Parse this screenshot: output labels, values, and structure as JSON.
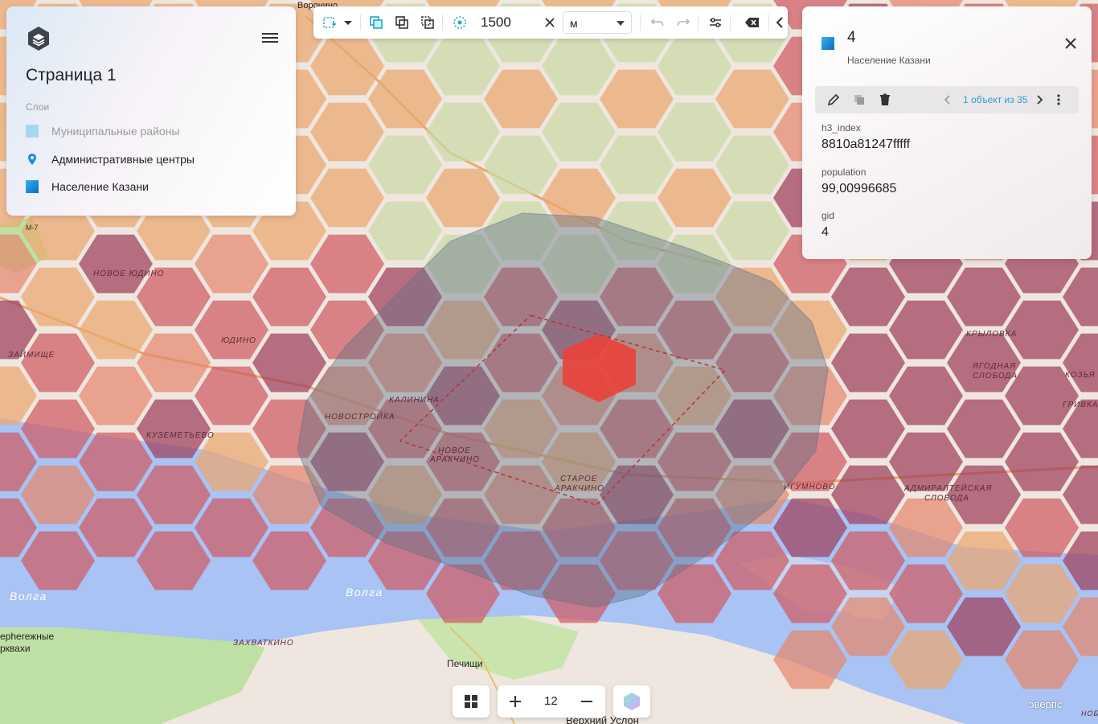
{
  "map": {
    "labels": [
      {
        "text": "Воронино",
        "cls": "place"
      },
      {
        "text": "НОВОЕ ЮДИНО",
        "cls": "district"
      },
      {
        "text": "ЮДИНО",
        "cls": "district"
      },
      {
        "text": "ЗАЙМИЩЕ",
        "cls": "district"
      },
      {
        "text": "КУЗЕМЕТЬЕВО",
        "cls": "district"
      },
      {
        "text": "КАЛИНИНА",
        "cls": "district"
      },
      {
        "text": "НОВОСТРОЙКА",
        "cls": "district"
      },
      {
        "text": "НОВОЕ",
        "cls": "district"
      },
      {
        "text": "АРАКЧИНО",
        "cls": "district"
      },
      {
        "text": "СТАРОЕ",
        "cls": "district"
      },
      {
        "text": "АРАКЧИНО",
        "cls": "district"
      },
      {
        "text": "ИГУМНОВО",
        "cls": "district"
      },
      {
        "text": "АДМИРАЛТЕЙСКАЯ",
        "cls": "district"
      },
      {
        "text": "СЛОБОДА",
        "cls": "district"
      },
      {
        "text": "КРЫЛОВКА",
        "cls": "district"
      },
      {
        "text": "ЯГОДНАЯ",
        "cls": "district"
      },
      {
        "text": "СЛОБОДА",
        "cls": "district"
      },
      {
        "text": "КОЗЬЯ",
        "cls": "district"
      },
      {
        "text": "ГРИВКА",
        "cls": "district"
      },
      {
        "text": "Волга",
        "cls": "river"
      },
      {
        "text": "Волга",
        "cls": "river"
      },
      {
        "text": "ЗАХВАТКИНО",
        "cls": "district"
      },
      {
        "text": "Печищи",
        "cls": "place"
      },
      {
        "text": "Верхний Услон",
        "cls": "place"
      },
      {
        "text": "ерherежные",
        "cls": "place"
      },
      {
        "text": "рквахи",
        "cls": "place"
      },
      {
        "text": "М-7",
        "cls": "shield"
      },
      {
        "text": "НОБ",
        "cls": "district"
      }
    ],
    "colors": {
      "hex_green": "#c9d9a6",
      "hex_orange": "#eaa870",
      "hex_salmon": "#e4886e",
      "hex_red": "#cf5b63",
      "hex_maroon": "#9e3f5b",
      "hex_selected": "#e8433b",
      "buffer": "#5f6f86",
      "water": "#a8c3f4"
    }
  },
  "left_panel": {
    "page_title": "Страница 1",
    "layers_label": "Слои",
    "layers": [
      {
        "label": "Муниципальные районы",
        "icon": "polygon-layer-icon",
        "color": "#a7d6f3",
        "dim": true
      },
      {
        "label": "Административные центры",
        "icon": "map-pin-icon",
        "color": "#1c8fd6",
        "dim": false
      },
      {
        "label": "Население Казани",
        "icon": "polygon-layer-icon",
        "color": "#1c8fd6",
        "dim": false
      }
    ]
  },
  "toolbar": {
    "distance_value": "1500",
    "unit": "м"
  },
  "info_panel": {
    "title": "4",
    "subtitle": "Население Казани",
    "counter": "1 объект из 35",
    "attributes": [
      {
        "key": "h3_index",
        "value": "8810a81247fffff"
      },
      {
        "key": "population",
        "value": "99,00996685"
      },
      {
        "key": "gid",
        "value": "4"
      }
    ]
  },
  "bottom": {
    "zoom": "12"
  },
  "watermark": "эверпс"
}
